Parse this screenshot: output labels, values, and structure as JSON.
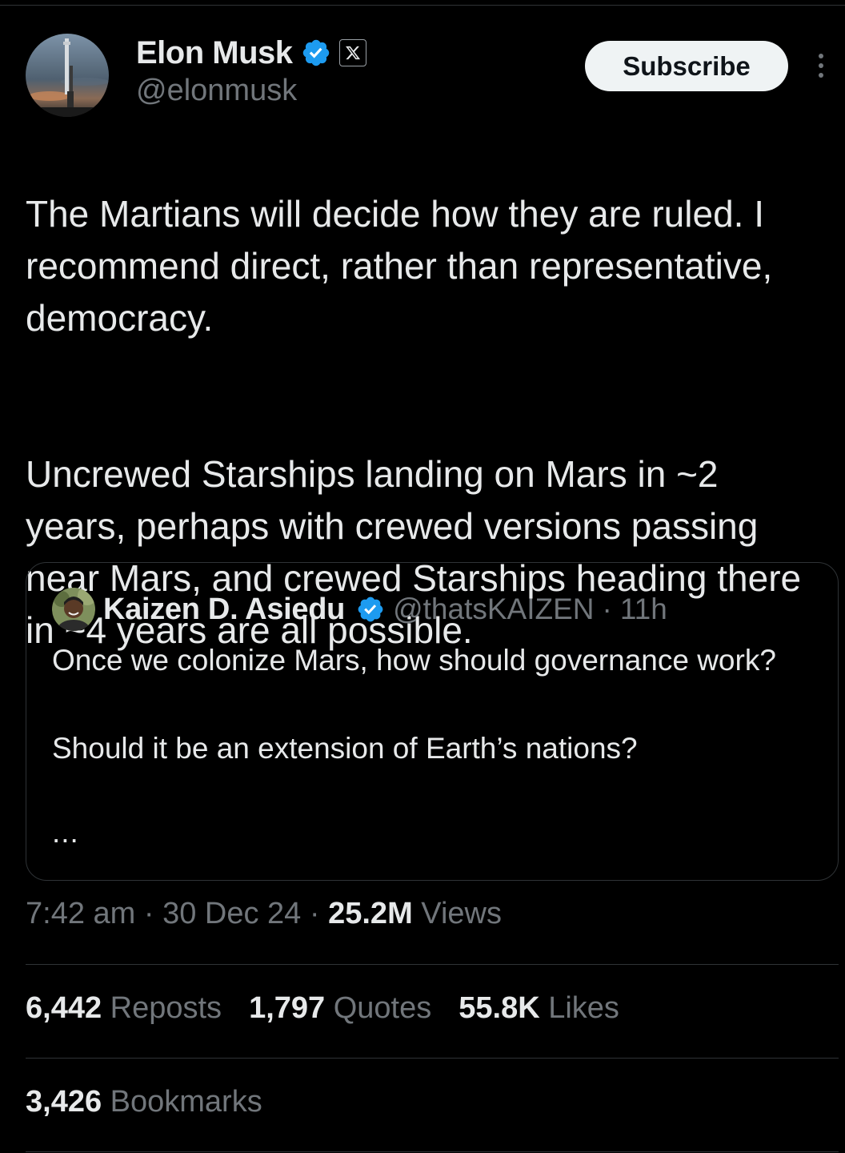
{
  "author": {
    "display_name": "Elon Musk",
    "handle": "@elonmusk",
    "verified": true,
    "affiliation_badge": "x-logo-icon"
  },
  "header": {
    "subscribe_label": "Subscribe"
  },
  "tweet": {
    "paragraph_1": "The Martians will decide how they are ruled. I recommend direct, rather than representative, democracy.",
    "paragraph_2": "Uncrewed Starships landing on Mars in ~2 years, perhaps with crewed versions passing near Mars, and crewed Starships heading there in ~4 years are all possible."
  },
  "quoted_tweet": {
    "display_name": "Kaizen D. Asiedu",
    "handle": "@thatsKAIZEN",
    "separator": "·",
    "time": "11h",
    "paragraph_1": "Once we colonize Mars, how should governance work?",
    "paragraph_2": "Should it be an extension of Earth’s nations?",
    "ellipsis": "..."
  },
  "meta": {
    "time": "7:42 am",
    "separator": "·",
    "date": "30 Dec 24",
    "views_count": "25.2M",
    "views_label": "Views"
  },
  "stats": {
    "reposts": {
      "count": "6,442",
      "label": "Reposts"
    },
    "quotes": {
      "count": "1,797",
      "label": "Quotes"
    },
    "likes": {
      "count": "55.8K",
      "label": "Likes"
    },
    "bookmarks": {
      "count": "3,426",
      "label": "Bookmarks"
    }
  },
  "colors": {
    "background": "#000000",
    "text_primary": "#e7e9ea",
    "text_secondary": "#71767b",
    "border": "#2f3336",
    "verified_blue": "#1d9bf0",
    "button_bg": "#eff3f4"
  }
}
